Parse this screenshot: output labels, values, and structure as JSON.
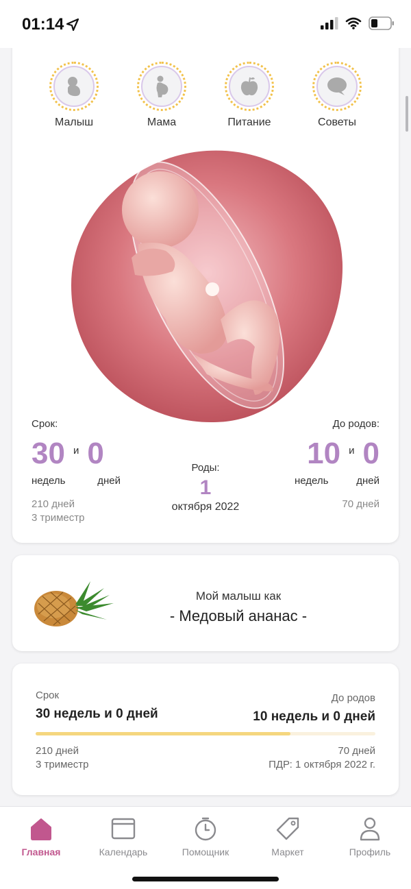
{
  "status_bar": {
    "time": "01:14"
  },
  "categories": [
    {
      "label": "Малыш",
      "icon": "baby-icon"
    },
    {
      "label": "Мама",
      "icon": "pregnant-woman-icon"
    },
    {
      "label": "Питание",
      "icon": "apple-icon"
    },
    {
      "label": "Советы",
      "icon": "speech-bubble-icon"
    }
  ],
  "term": {
    "label": "Срок:",
    "weeks": "30",
    "and": "и",
    "days": "0",
    "weeks_unit": "недель",
    "days_unit": "дней",
    "total_days": "210 дней",
    "trimester": "3 триместр"
  },
  "birth": {
    "label": "Роды:",
    "day": "1",
    "month_year": "октября 2022"
  },
  "until_birth": {
    "label": "До родов:",
    "weeks": "10",
    "and": "и",
    "days": "0",
    "weeks_unit": "недель",
    "days_unit": "дней",
    "total_days": "70 дней"
  },
  "fruit": {
    "line1": "Мой малыш как",
    "line2": "- Медовый ананас -",
    "icon": "pineapple-icon"
  },
  "progress": {
    "left_label": "Срок",
    "left_value": "30 недель и 0 дней",
    "right_label": "До родов",
    "right_value": "10 недель и 0 дней",
    "fraction": 0.75,
    "left_days": "210 дней",
    "left_trimester": "3 триместр",
    "right_days": "70 дней",
    "due_date": "ПДР: 1 октября 2022 г.",
    "fill_color": "#f5d67e"
  },
  "tabs": [
    {
      "label": "Главная",
      "icon": "home-icon",
      "active": true
    },
    {
      "label": "Календарь",
      "icon": "calendar-icon",
      "active": false
    },
    {
      "label": "Помощник",
      "icon": "stopwatch-icon",
      "active": false
    },
    {
      "label": "Маркет",
      "icon": "tag-icon",
      "active": false
    },
    {
      "label": "Профиль",
      "icon": "person-icon",
      "active": false
    }
  ],
  "colors": {
    "accent_purple": "#b185c2",
    "active_pink": "#c1578e",
    "ring_yellow": "#f2c24c"
  }
}
